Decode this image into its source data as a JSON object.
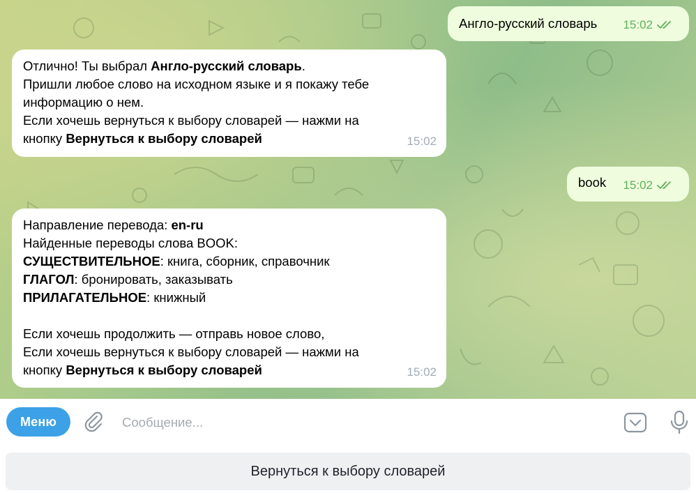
{
  "messages": [
    {
      "direction": "outgoing",
      "text": "Англо-русский словарь",
      "time": "15:02",
      "status": "read"
    },
    {
      "direction": "incoming",
      "lines": [
        [
          {
            "t": "Отлично! Ты выбрал "
          },
          {
            "t": "Англо-русский словарь",
            "b": true
          },
          {
            "t": "."
          }
        ],
        [
          {
            "t": "Пришли любое слово на исходном языке и я покажу тебе"
          }
        ],
        [
          {
            "t": "информацию о нем."
          }
        ],
        [
          {
            "t": "Если хочешь вернуться к выбору словарей — нажми на"
          }
        ],
        [
          {
            "t": "кнопку "
          },
          {
            "t": "Вернуться к выбору словарей",
            "b": true
          }
        ]
      ],
      "time": "15:02"
    },
    {
      "direction": "outgoing",
      "text": "book",
      "time": "15:02",
      "status": "read"
    },
    {
      "direction": "incoming",
      "lines": [
        [
          {
            "t": "Направление перевода: "
          },
          {
            "t": "en-ru",
            "b": true
          }
        ],
        [
          {
            "t": "Найденные переводы слова BOOK:"
          }
        ],
        [
          {
            "t": "СУЩЕСТВИТЕЛЬНОЕ",
            "b": true
          },
          {
            "t": ": книга, сборник, справочник"
          }
        ],
        [
          {
            "t": "ГЛАГОЛ",
            "b": true
          },
          {
            "t": ": бронировать, заказывать"
          }
        ],
        [
          {
            "t": "ПРИЛАГАТЕЛЬНОЕ",
            "b": true
          },
          {
            "t": ": книжный"
          }
        ],
        [],
        [
          {
            "t": "Если хочешь продолжить — отправь новое слово,"
          }
        ],
        [
          {
            "t": "Если хочешь вернуться к выбору словарей — нажми на"
          }
        ],
        [
          {
            "t": "кнопку "
          },
          {
            "t": "Вернуться к выбору словарей",
            "b": true
          }
        ]
      ],
      "time": "15:02"
    }
  ],
  "composer": {
    "menu_label": "Меню",
    "placeholder": "Сообщение...",
    "value": "",
    "icons": [
      "paperclip-icon",
      "keyboard-icon",
      "microphone-icon"
    ]
  },
  "reply_keyboard": {
    "buttons": [
      "Вернуться к выбору словарей"
    ]
  },
  "colors": {
    "accent": "#3ca1e6",
    "outgoing_bubble": "#effdde",
    "incoming_bubble": "#ffffff",
    "read_check": "#5fb15a",
    "time_incoming": "#a0acb6"
  }
}
